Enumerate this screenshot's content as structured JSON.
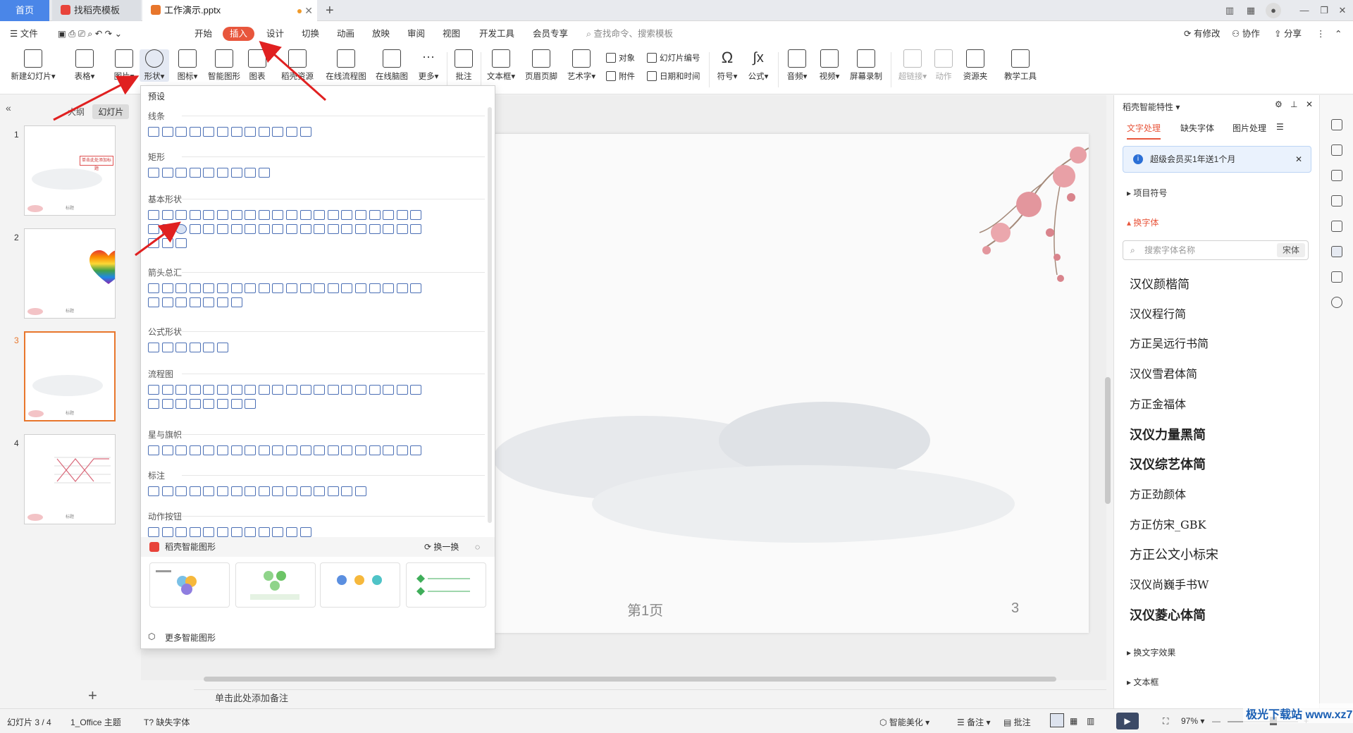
{
  "tabs": {
    "home": "首页",
    "template": "找稻壳模板",
    "doc": "工作演示.pptx"
  },
  "menu": [
    "文件",
    "开始",
    "插入",
    "设计",
    "切换",
    "动画",
    "放映",
    "审阅",
    "视图",
    "开发工具",
    "会员专享"
  ],
  "menu_search": "查找命令、搜索模板",
  "menu_right": {
    "modified": "有修改",
    "collab": "协作",
    "share": "分享"
  },
  "ribbon": {
    "new_slide": "新建幻灯片",
    "table": "表格",
    "picture": "图片",
    "shape": "形状",
    "icon": "图标",
    "smart_graphic": "智能图形",
    "chart": "图表",
    "docer": "稻壳资源",
    "flowchart": "在线流程图",
    "mindmap": "在线脑图",
    "more": "更多",
    "comment": "批注",
    "textbox": "文本框",
    "header_footer": "页眉页脚",
    "wordart": "艺术字",
    "object": "对象",
    "attachment": "附件",
    "slide_number": "幻灯片编号",
    "datetime": "日期和时间",
    "symbol": "符号",
    "formula": "公式",
    "audio": "音频",
    "video": "视频",
    "screen_record": "屏幕录制",
    "hyperlink": "超链接",
    "action": "动作",
    "resources": "资源夹",
    "teaching": "教学工具"
  },
  "left_panel": {
    "tab_outline": "大纲",
    "tab_slides": "幻灯片",
    "thumb_foot": "标题",
    "thumb1_title": "单击此处添加标题"
  },
  "slides": [
    {
      "num": "1"
    },
    {
      "num": "2"
    },
    {
      "num": "3"
    },
    {
      "num": "4"
    }
  ],
  "slide": {
    "page_label": "第1页",
    "page_number": "3"
  },
  "notes_placeholder": "单击此处添加备注",
  "dropdown": {
    "preset": "预设",
    "sections": [
      "线条",
      "矩形",
      "基本形状",
      "箭头总汇",
      "公式形状",
      "流程图",
      "星与旗帜",
      "标注",
      "动作按钮"
    ],
    "smart_shapes": "稻壳智能图形",
    "swap": "换一换",
    "more_smart": "更多智能图形"
  },
  "right_panel": {
    "title": "稻壳智能特性",
    "tabs": [
      "文字处理",
      "缺失字体",
      "图片处理"
    ],
    "banner": "超级会员买1年送1个月",
    "bullets": "项目符号",
    "change_font": "换字体",
    "search_placeholder": "搜索字体名称",
    "search_font": "宋体",
    "fonts": [
      "汉仪颜楷简",
      "汉仪程行简",
      "方正吴远行书简",
      "汉仪雪君体简",
      "方正金福体",
      "汉仪力量黑简",
      "汉仪综艺体简",
      "方正劲颜体",
      "方正仿宋_GBK",
      "方正公文小标宋",
      "汉仪尚巍手书W",
      "汉仪菱心体简"
    ],
    "text_effects": "换文字效果",
    "textbox": "文本框"
  },
  "status": {
    "slide_info": "幻灯片 3 / 4",
    "theme": "1_Office 主题",
    "missing_font": "缺失字体",
    "beautify": "智能美化",
    "notes": "备注",
    "comment": "批注",
    "zoom": "97%"
  },
  "watermark": "极光下载站 www.xz7.com",
  "colors": {
    "accent": "#e8563c",
    "blue": "#4a86e8",
    "arrow": "#e02020"
  }
}
